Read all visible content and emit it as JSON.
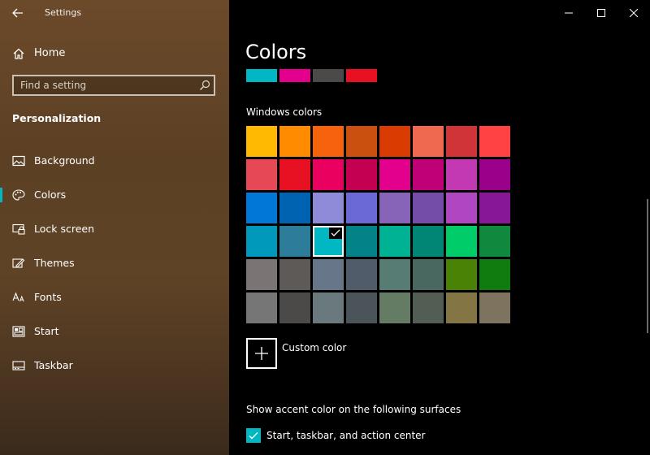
{
  "window": {
    "title": "Settings",
    "controls": [
      "minimize",
      "maximize",
      "close"
    ]
  },
  "sidebar": {
    "home_label": "Home",
    "search_placeholder": "Find a setting",
    "section_title": "Personalization",
    "items": [
      {
        "label": "Background",
        "icon": "picture-icon",
        "selected": false
      },
      {
        "label": "Colors",
        "icon": "palette-icon",
        "selected": true
      },
      {
        "label": "Lock screen",
        "icon": "lock-screen-icon",
        "selected": false
      },
      {
        "label": "Themes",
        "icon": "themes-icon",
        "selected": false
      },
      {
        "label": "Fonts",
        "icon": "fonts-icon",
        "selected": false
      },
      {
        "label": "Start",
        "icon": "start-icon",
        "selected": false
      },
      {
        "label": "Taskbar",
        "icon": "taskbar-icon",
        "selected": false
      }
    ]
  },
  "main": {
    "title": "Colors",
    "recent_colors": [
      "#00b7c3",
      "#e3008c",
      "#4c4a48",
      "#e81123"
    ],
    "windows_colors_label": "Windows colors",
    "windows_colors": [
      [
        "#ffb900",
        "#ff8c00",
        "#f7630c",
        "#ca5010",
        "#da3b01",
        "#ef6950",
        "#d13438",
        "#ff4343"
      ],
      [
        "#e74856",
        "#e81123",
        "#ea005e",
        "#c30052",
        "#e3008c",
        "#bf0077",
        "#c239b3",
        "#9a0089"
      ],
      [
        "#0078d7",
        "#0063b1",
        "#8e8cd8",
        "#6b69d6",
        "#8764b8",
        "#744da9",
        "#b146c2",
        "#881798"
      ],
      [
        "#0099bc",
        "#2d7d9a",
        "#00b7c3",
        "#038387",
        "#00b294",
        "#018574",
        "#00cc6a",
        "#10893e"
      ],
      [
        "#7a7574",
        "#5d5a58",
        "#68768a",
        "#515c6b",
        "#567c73",
        "#486860",
        "#498205",
        "#107c10"
      ],
      [
        "#767676",
        "#4c4a48",
        "#69797e",
        "#4a5459",
        "#647c64",
        "#525e54",
        "#847545",
        "#7e735f"
      ]
    ],
    "selected_color": "#00b7c3",
    "custom_color_label": "Custom color",
    "surfaces_label": "Show accent color on the following surfaces",
    "checkbox_label": "Start, taskbar, and action center",
    "checkbox_checked": true,
    "accent_color": "#00b7c3"
  }
}
